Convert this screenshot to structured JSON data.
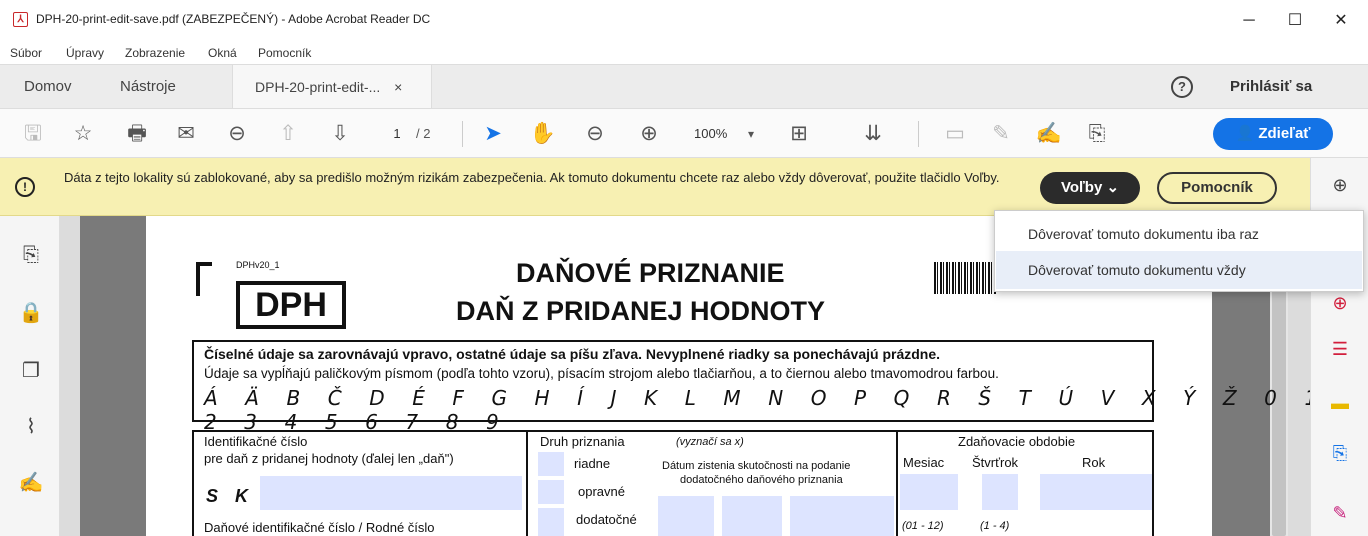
{
  "window": {
    "title": "DPH-20-print-edit-save.pdf (ZABEZPEČENÝ) - Adobe Acrobat Reader DC",
    "minimize": "─",
    "maximize": "☐",
    "close": "✕"
  },
  "menu": [
    "Súbor",
    "Úpravy",
    "Zobrazenie",
    "Okná",
    "Pomocník"
  ],
  "tabs": {
    "home": "Domov",
    "tools": "Nástroje",
    "doc": "DPH-20-print-edit-...",
    "doc_close": "×",
    "help_icon": "?",
    "signin": "Prihlásiť sa"
  },
  "toolbar": {
    "page_current": "1",
    "page_total": "/ 2",
    "zoom": "100%",
    "share": "Zdieľať",
    "icons": [
      "save-icon",
      "bookmark-star-icon",
      "print-icon",
      "email-icon",
      "zoom-search-icon",
      "page-up-icon",
      "page-down-icon",
      "select-cursor-icon",
      "hand-icon",
      "zoom-out-icon",
      "zoom-in-icon",
      "fit-page-icon",
      "scroll-mode-icon",
      "comment-icon",
      "highlight-icon",
      "sign-icon",
      "share-file-icon"
    ]
  },
  "alert": {
    "text": "Dáta z tejto lokality sú zablokované, aby sa predišlo možným rizikám zabezpečenia. Ak tomuto dokumentu chcete raz alebo vždy dôverovať, použite tlačidlo Voľby.",
    "options_button": "Voľby",
    "help_button": "Pomocník"
  },
  "dropdown": {
    "items": [
      "Dôverovať tomuto dokumentu iba raz",
      "Dôverovať tomuto dokumentu vždy"
    ]
  },
  "form": {
    "code": "DPHv20_1",
    "badge": "DPH",
    "title1": "DAŇOVÉ PRIZNANIE",
    "title2": "DAŇ Z PRIDANEJ HODNOTY",
    "instr1": "Číselné údaje sa zarovnávajú vpravo, ostatné údaje sa píšu zľava. Nevyplnené riadky sa ponechávajú prázdne.",
    "instr2": "Údaje sa vypĺňajú paličkovým písmom (podľa tohto vzoru), písacím strojom alebo tlačiarňou, a to čiernou alebo tmavomodrou farbou.",
    "alphabet": "Á Ä B Č D É F G H Í J K L M N O P Q R Š T Ú V X Ý Ž   0 1 2 3 4 5 6 7 8 9",
    "id_label1": "Identifikačné číslo",
    "id_label2": "pre daň z pridanej hodnoty (ďalej len „daň\")",
    "sk": "S K",
    "tax_id_label": "Daňové identifikačné číslo / Rodné číslo",
    "type_label": "Druh priznania",
    "type_hint": "(vyznačí sa x)",
    "type_regular": "riadne",
    "type_correction": "opravné",
    "type_additional": "dodatočné",
    "date_label1": "Dátum zistenia skutočnosti na podanie",
    "date_label2": "dodatočného daňového priznania",
    "period_label": "Zdaňovacie obdobie",
    "month": "Mesiac",
    "quarter": "Štvrťrok",
    "year": "Rok",
    "month_range": "(01 - 12)",
    "quarter_range": "(1 - 4)"
  }
}
